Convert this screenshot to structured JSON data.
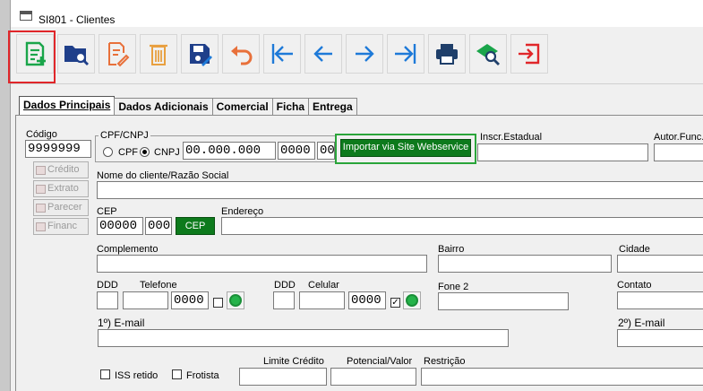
{
  "window": {
    "title": "SI801 - Clientes"
  },
  "toolbar": {
    "buttons": [
      {
        "name": "new-record-icon",
        "color": "#1aa54a"
      },
      {
        "name": "search-folder-icon",
        "color": "#1f4fa8"
      },
      {
        "name": "edit-icon",
        "color": "#e8703a"
      },
      {
        "name": "delete-icon",
        "color": "#e8a040"
      },
      {
        "name": "save-icon",
        "color": "#1f4fa8"
      },
      {
        "name": "undo-icon",
        "color": "#e8703a"
      },
      {
        "name": "first-icon",
        "color": "#1e7ad8"
      },
      {
        "name": "previous-icon",
        "color": "#1e7ad8"
      },
      {
        "name": "next-icon",
        "color": "#1e7ad8"
      },
      {
        "name": "last-icon",
        "color": "#1e7ad8"
      },
      {
        "name": "print-icon",
        "color": "#1f3f6a"
      },
      {
        "name": "search-view-icon",
        "color": "#1aa54a"
      },
      {
        "name": "exit-icon",
        "color": "#e0262a"
      }
    ]
  },
  "tabs": [
    {
      "label": "Dados Principais",
      "active": true
    },
    {
      "label": "Dados Adicionais",
      "active": false
    },
    {
      "label": "Comercial",
      "active": false
    },
    {
      "label": "Ficha",
      "active": false
    },
    {
      "label": "Entrega",
      "active": false
    }
  ],
  "form": {
    "codigo_label": "Código",
    "codigo_value": "9999999",
    "side_buttons": [
      "Crédito",
      "Extrato",
      "Parecer",
      "Financ"
    ],
    "cpfcnpj_label": "CPF/CNPJ",
    "cpf_label": "CPF",
    "cnpj_label": "CNPJ",
    "cnpj_part1": "00.000.000",
    "cnpj_part2": "0000",
    "cnpj_part3": "00",
    "webservice_button": "Importar via Site Webservice",
    "inscr_label": "Inscr.Estadual",
    "autor_label": "Autor.Func.",
    "nome_label": "Nome do cliente/Razão Social",
    "cep_label": "CEP",
    "cep_part1": "00000",
    "cep_part2": "000",
    "cep_button": "CEP",
    "endereco_label": "Endereço",
    "complemento_label": "Complemento",
    "bairro_label": "Bairro",
    "cidade_label": "Cidade",
    "ddd1_label": "DDD",
    "telefone_label": "Telefone",
    "telefone_value": "0000",
    "ddd2_label": "DDD",
    "celular_label": "Celular",
    "celular_value": "0000",
    "fone2_label": "Fone 2",
    "contato_label": "Contato",
    "email1_label": "1º) E-mail",
    "email2_label": "2º) E-mail",
    "iss_label": "ISS retido",
    "frotista_label": "Frotista",
    "limite_label": "Limite Crédito",
    "potencial_label": "Potencial/Valor",
    "restricao_label": "Restrição"
  }
}
